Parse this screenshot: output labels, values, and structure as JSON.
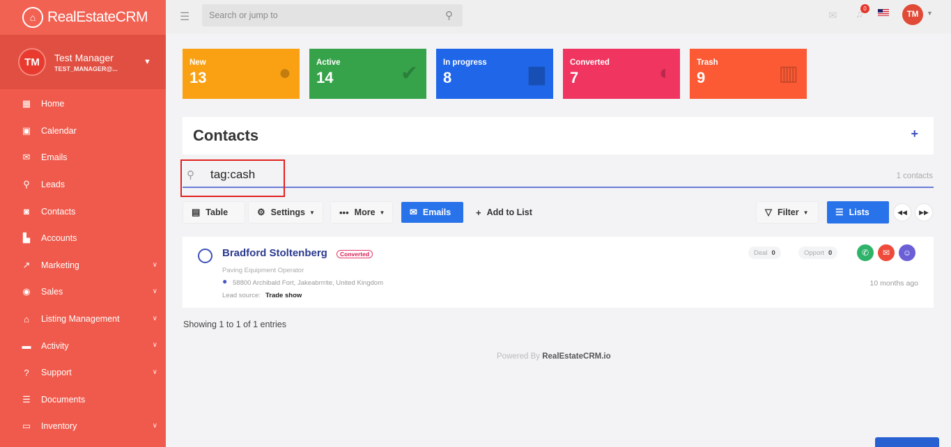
{
  "app": {
    "brand": "RealEstateCRM",
    "brand_icon": "chart-house-icon"
  },
  "user": {
    "initials": "TM",
    "name": "Test Manager",
    "email": "TEST_MANAGER@..."
  },
  "sidebar": {
    "items": [
      {
        "label": "Home",
        "icon": "grid-icon",
        "has_submenu": false
      },
      {
        "label": "Calendar",
        "icon": "calendar-icon",
        "has_submenu": false
      },
      {
        "label": "Emails",
        "icon": "envelope-icon",
        "has_submenu": false
      },
      {
        "label": "Leads",
        "icon": "search-icon",
        "has_submenu": false
      },
      {
        "label": "Contacts",
        "icon": "contact-icon",
        "has_submenu": false
      },
      {
        "label": "Accounts",
        "icon": "building-icon",
        "has_submenu": false
      },
      {
        "label": "Marketing",
        "icon": "trend-icon",
        "has_submenu": true
      },
      {
        "label": "Sales",
        "icon": "target-icon",
        "has_submenu": true
      },
      {
        "label": "Listing Management",
        "icon": "house-icon",
        "has_submenu": true
      },
      {
        "label": "Activity",
        "icon": "briefcase-icon",
        "has_submenu": true
      },
      {
        "label": "Support",
        "icon": "help-icon",
        "has_submenu": true
      },
      {
        "label": "Documents",
        "icon": "list-icon",
        "has_submenu": false
      },
      {
        "label": "Inventory",
        "icon": "laptop-icon",
        "has_submenu": true
      }
    ]
  },
  "topbar": {
    "search_placeholder": "Search or jump to",
    "notification_count": "0",
    "avatar_initials": "TM"
  },
  "stats": [
    {
      "label": "New",
      "count": "13",
      "color": "#f9a113",
      "icon": "person-icon"
    },
    {
      "label": "Active",
      "count": "14",
      "color": "#36a34a",
      "icon": "check-icon"
    },
    {
      "label": "In progress",
      "count": "8",
      "color": "#1f66e8",
      "icon": "briefcase-icon"
    },
    {
      "label": "Converted",
      "count": "7",
      "color": "#ef3560",
      "icon": "half-circle-icon"
    },
    {
      "label": "Trash",
      "count": "9",
      "color": "#fb5a34",
      "icon": "trash-icon"
    }
  ],
  "contacts": {
    "title": "Contacts",
    "filter_value": "tag:cash",
    "count_label": "1 contacts",
    "toolbar": {
      "table": "Table",
      "settings": "Settings",
      "more": "More",
      "emails": "Emails",
      "add_to_list": "Add to List",
      "filter": "Filter",
      "lists": "Lists"
    },
    "rows": [
      {
        "name": "Bradford Stoltenberg",
        "status": "Converted",
        "job": "Paving Equipment Operator",
        "address": "58800 Archibald Fort, Jakeabrrrite, United Kingdom",
        "lead_source_label": "Lead source:",
        "lead_source": "Trade show",
        "deal_label": "Deal",
        "deal_count": "0",
        "opport_label": "Opport",
        "opport_count": "0",
        "time_ago": "10 months ago"
      }
    ],
    "showing": "Showing 1 to 1 of 1 entries"
  },
  "footer": {
    "prefix": "Powered By",
    "brand": "RealEstateCRM.io"
  },
  "colors": {
    "sidebar": "#f05a4c",
    "accent_blue": "#2872ea",
    "converted": "#e8336a"
  }
}
